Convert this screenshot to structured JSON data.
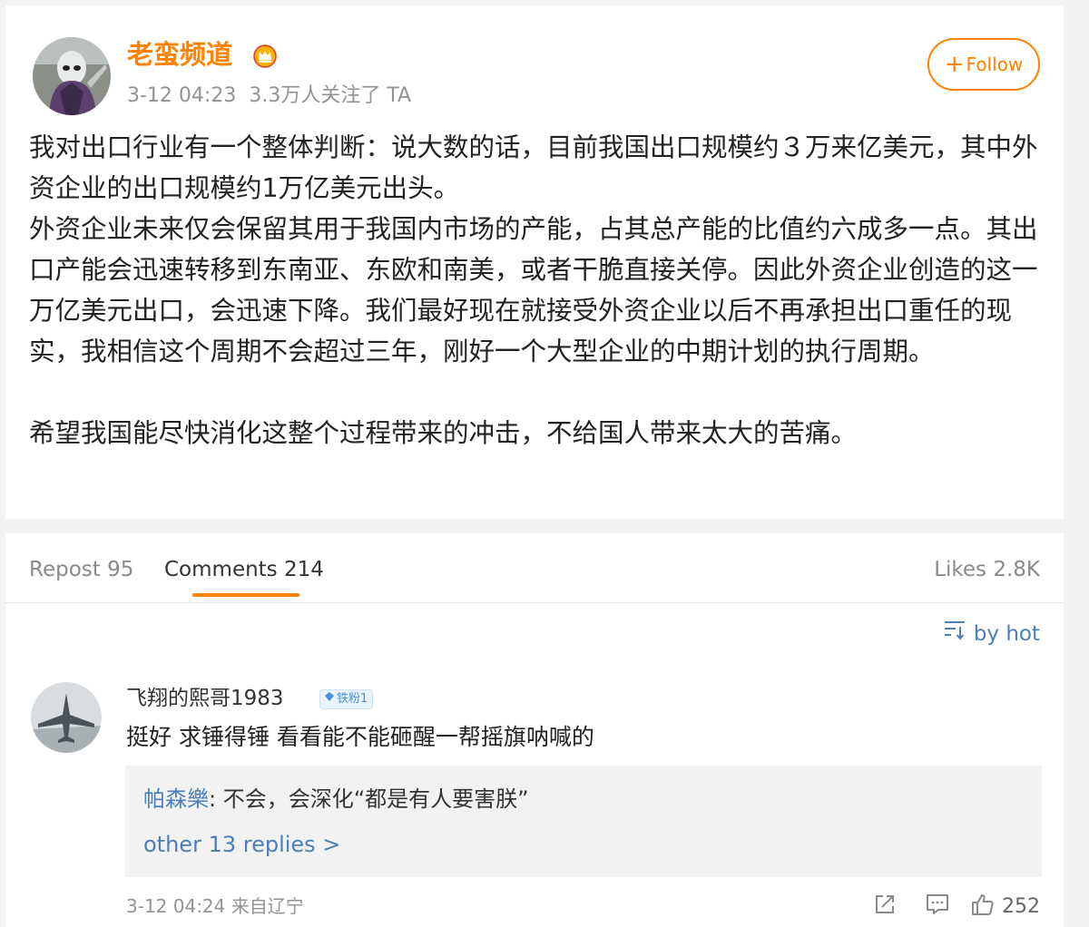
{
  "post": {
    "author": "老蛮频道",
    "timestamp": "3-12 04:23",
    "followers": "3.3万人关注了 TA",
    "follow_label": "Follow",
    "paragraphs": [
      "我对出口行业有一个整体判断：说大数的话，目前我国出口规模约３万来亿美元，其中外资企业的出口规模约1万亿美元出头。",
      "外资企业未来仅会保留其用于我国内市场的产能，占其总产能的比值约六成多一点。其出口产能会迅速转移到东南亚、东欧和南美，或者干脆直接关停。因此外资企业创造的这一万亿美元出口，会迅速下降。我们最好现在就接受外资企业以后不再承担出口重任的现实，我相信这个周期不会超过三年，刚好一个大型企业的中期计划的执行周期。",
      "",
      "希望我国能尽快消化这整个过程带来的冲击，不给国人带来太大的苦痛。"
    ]
  },
  "tabs": {
    "repost": "Repost 95",
    "comments": "Comments 214",
    "likes": "Likes 2.8K"
  },
  "sort_label": "by hot",
  "comment": {
    "user": "飞翔的熙哥1983",
    "badge": "铁粉1",
    "text": "挺好 求锤得锤 看看能不能砸醒一帮摇旗呐喊的",
    "reply_user": "帕森樂",
    "reply_text": ": 不会，会深化“都是有人要害朕”",
    "more_replies": "other 13 replies >",
    "timestamp": "3-12 04:24",
    "location": "来自辽宁",
    "like_count": "252"
  },
  "colors": {
    "accent": "#ff8200",
    "link": "#4c7eba",
    "meta": "#939393",
    "background": "#f2f2f2"
  },
  "icons": {
    "crown": "crown-icon",
    "sort": "sort-icon",
    "share": "share-icon",
    "comment": "comment-icon",
    "like": "thumbs-up-icon",
    "badge": "diamond-icon"
  }
}
